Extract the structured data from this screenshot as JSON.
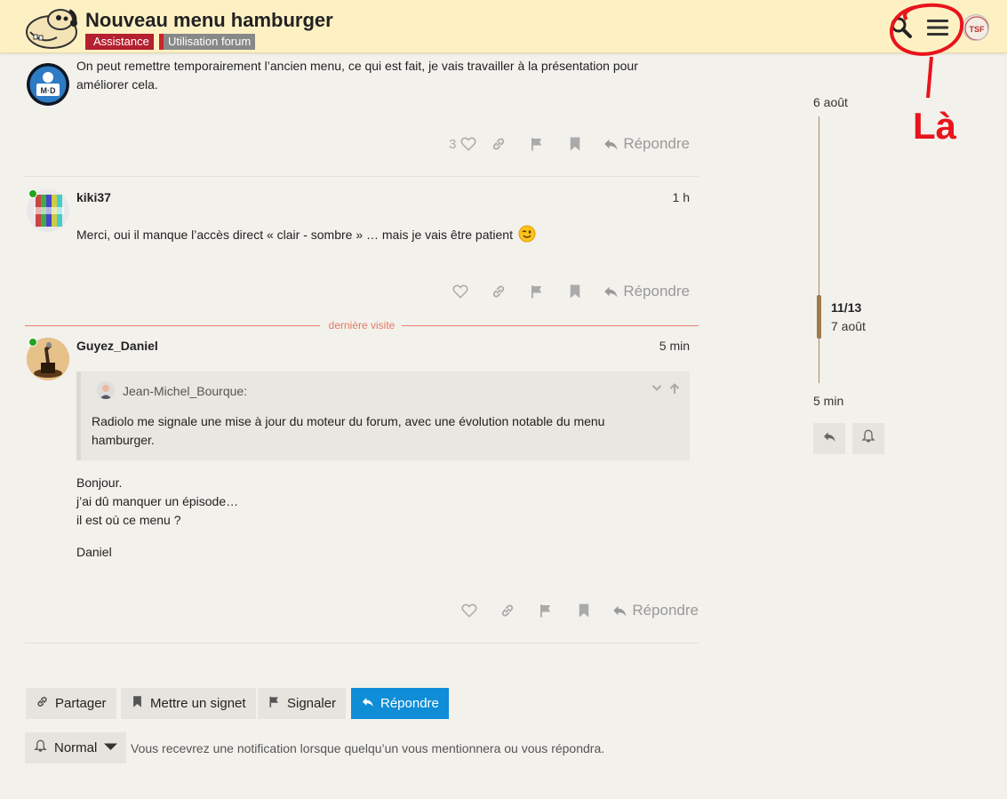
{
  "header": {
    "title": "Nouveau menu hamburger",
    "categories": [
      "Assistance",
      "Utilisation forum"
    ],
    "avatar_text": "TSF"
  },
  "annotation": {
    "text": "Là"
  },
  "posts": [
    {
      "avatar_text": "M·D",
      "text": "On peut remettre temporairement l’ancien menu, ce qui est fait, je vais travailler à la présentation pour améliorer cela.",
      "like_count": "3",
      "reply_label": "Répondre"
    },
    {
      "username": "kiki37",
      "time": "1 h",
      "text": "Merci, oui il manque l’accès direct « clair - sombre » … mais je vais être patient",
      "reply_label": "Répondre"
    },
    {
      "username": "Guyez_Daniel",
      "time": "5 min",
      "quote": {
        "user": "Jean-Michel_Bourque:",
        "text": "Radiolo me signale une mise à jour du moteur du forum, avec une évolution notable du menu hamburger."
      },
      "lines": [
        "Bonjour.",
        "j’ai dû manquer un épisode…",
        "il est où ce menu ?",
        "Daniel"
      ],
      "reply_label": "Répondre"
    }
  ],
  "last_visit": "dernière visite",
  "timeline": {
    "start_date": "6 août",
    "position": "11/13",
    "position_date": "7 août",
    "end_date": "5 min",
    "progress": 0.77
  },
  "footer": {
    "share": "Partager",
    "bookmark": "Mettre un signet",
    "flag": "Signaler",
    "reply": "Répondre",
    "notification_level": "Normal",
    "notification_desc": "Vous recevrez une notification lorsque quelqu’un vous mentionnera ou vous répondra."
  },
  "colors": {
    "header_bg": "#fdf1c4",
    "accent_blue": "#0f8dd6",
    "category_red": "#b4202f",
    "annotation_red": "#e8141c",
    "online_green": "#1ea51e"
  }
}
